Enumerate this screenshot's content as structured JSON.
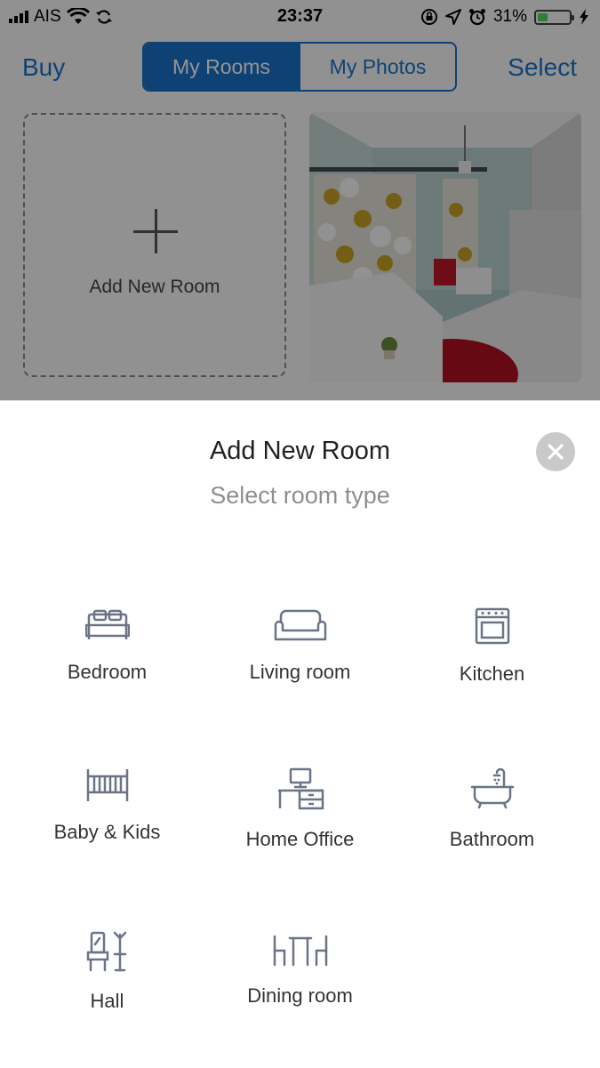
{
  "status": {
    "carrier": "AIS",
    "time": "23:37",
    "battery": "31%",
    "battery_level": 0.31,
    "icons": [
      "signal-icon",
      "wifi-icon",
      "sync-icon",
      "rotation-lock-icon",
      "location-icon",
      "alarm-icon",
      "battery-icon",
      "charging-icon"
    ]
  },
  "nav": {
    "buy_label": "Buy",
    "select_label": "Select",
    "tabs": [
      {
        "label": "My Rooms",
        "active": true
      },
      {
        "label": "My Photos",
        "active": false
      }
    ]
  },
  "gallery": {
    "add_label": "Add New Room"
  },
  "sheet": {
    "title": "Add New Room",
    "subtitle": "Select room type",
    "rooms": [
      {
        "label": "Bedroom",
        "icon": "bed-icon"
      },
      {
        "label": "Living room",
        "icon": "sofa-icon"
      },
      {
        "label": "Kitchen",
        "icon": "oven-icon"
      },
      {
        "label": "Baby & Kids",
        "icon": "crib-icon"
      },
      {
        "label": "Home Office",
        "icon": "desk-icon"
      },
      {
        "label": "Bathroom",
        "icon": "bathtub-icon"
      },
      {
        "label": "Hall",
        "icon": "hall-stand-icon"
      },
      {
        "label": "Dining room",
        "icon": "dining-table-icon"
      }
    ]
  },
  "colors": {
    "accent": "#1a73c8",
    "icon": "#6b7486",
    "close_bg": "#c9c9c9"
  }
}
